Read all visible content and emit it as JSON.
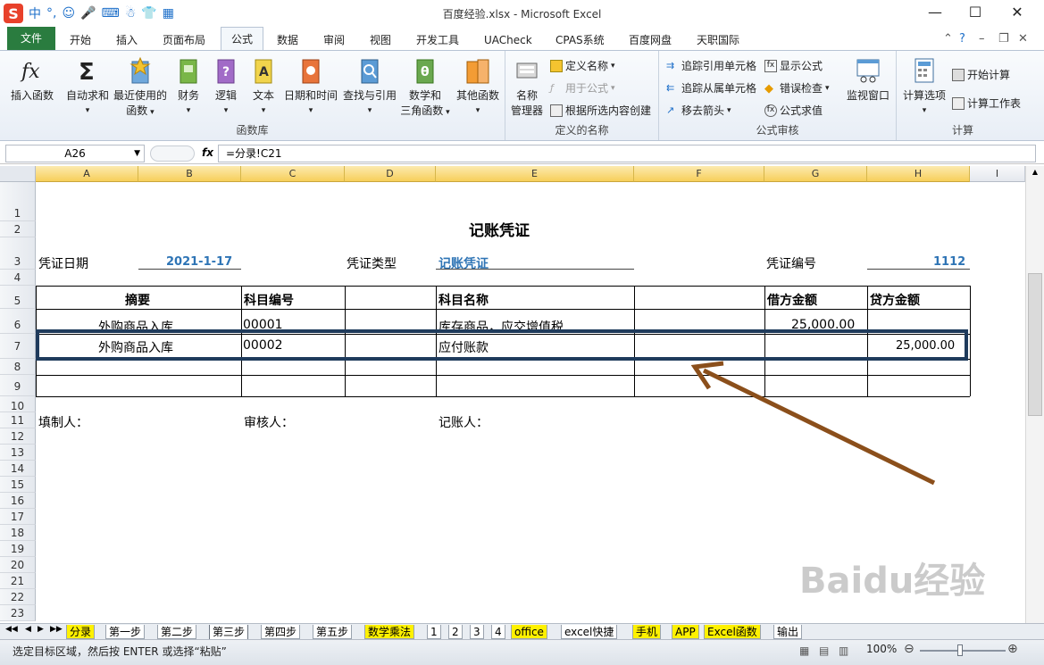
{
  "window": {
    "title": "百度经验.xlsx - Microsoft Excel"
  },
  "ime": {
    "label": "中"
  },
  "tabs": [
    "文件",
    "开始",
    "插入",
    "页面布局",
    "公式",
    "数据",
    "审阅",
    "视图",
    "开发工具",
    "UACheck",
    "CPAS系统",
    "百度网盘",
    "天职国际"
  ],
  "ribbon": {
    "function_library": {
      "label": "函数库",
      "buttons": {
        "insert_function": "插入函数",
        "autosum": "自动求和",
        "recent1": "最近使用的",
        "recent2": "函数",
        "financial": "财务",
        "logical": "逻辑",
        "text": "文本",
        "datetime": "日期和时间",
        "lookup": "查找与引用",
        "math1": "数学和",
        "math2": "三角函数",
        "more": "其他函数"
      }
    },
    "defined_names": {
      "label": "定义的名称",
      "buttons": {
        "name_manager1": "名称",
        "name_manager2": "管理器",
        "define_name": "定义名称",
        "use_in_formula": "用于公式",
        "create_from_selection": "根据所选内容创建"
      }
    },
    "formula_auditing": {
      "label": "公式审核",
      "buttons": {
        "trace_precedents": "追踪引用单元格",
        "trace_dependents": "追踪从属单元格",
        "remove_arrows": "移去箭头",
        "show_formulas": "显示公式",
        "error_checking": "错误检查",
        "evaluate": "公式求值",
        "watch_window": "监视窗口"
      }
    },
    "calculation": {
      "label": "计算",
      "buttons": {
        "options": "计算选项",
        "calc_now": "开始计算",
        "calc_sheet": "计算工作表"
      }
    }
  },
  "formula_bar": {
    "name_box": "A26",
    "fx": "fx",
    "formula": "=分录!C21"
  },
  "columns": [
    "A",
    "B",
    "C",
    "D",
    "E",
    "F",
    "G",
    "H",
    "I"
  ],
  "rows": [
    "1",
    "2",
    "3",
    "4",
    "5",
    "6",
    "7",
    "8",
    "9",
    "10",
    "11",
    "12",
    "13",
    "14",
    "15",
    "16",
    "17",
    "18",
    "19",
    "20",
    "21",
    "22",
    "23"
  ],
  "voucher": {
    "title": "记账凭证",
    "date_label": "凭证日期",
    "date_value": "2021-1-17",
    "type_label": "凭证类型",
    "type_value": "记账凭证",
    "number_label": "凭证编号",
    "number_value": "1112",
    "headers": {
      "summary": "摘要",
      "account_code": "科目编号",
      "account_name": "科目名称",
      "debit": "借方金额",
      "credit": "贷方金额"
    },
    "entries": [
      {
        "summary": "外购商品入库",
        "code": "00001",
        "name": "库存商品，应交增值税",
        "debit": "25,000.00",
        "credit": ""
      },
      {
        "summary": "外购商品入库",
        "code": "00002",
        "name": "应付账款",
        "debit": "",
        "credit": "25,000.00"
      }
    ],
    "footer": {
      "preparer": "填制人：",
      "reviewer": "审核人：",
      "bookkeeper": "记账人："
    }
  },
  "sheets": [
    {
      "label": "分录",
      "color": "yellow"
    },
    {
      "label": "第一步",
      "color": "none"
    },
    {
      "label": "第二步",
      "color": "none"
    },
    {
      "label": "第三步",
      "color": "active"
    },
    {
      "label": "第四步",
      "color": "none"
    },
    {
      "label": "第五步",
      "color": "none"
    },
    {
      "label": "数学乘法",
      "color": "yellow"
    },
    {
      "label": "1",
      "color": "none"
    },
    {
      "label": "2",
      "color": "none"
    },
    {
      "label": "3",
      "color": "none"
    },
    {
      "label": "4",
      "color": "none"
    },
    {
      "label": "office",
      "color": "yellow"
    },
    {
      "label": "excel快捷",
      "color": "none"
    },
    {
      "label": "手机",
      "color": "yellow"
    },
    {
      "label": "APP",
      "color": "yellow"
    },
    {
      "label": "Excel函数",
      "color": "yellow"
    },
    {
      "label": "输出",
      "color": "none"
    }
  ],
  "status": {
    "text": "选定目标区域，然后按 ENTER 或选择“粘贴”",
    "zoom": "100%"
  },
  "watermark": "Baidu经验",
  "colors": {
    "highlight_box": "#1f3b5c",
    "arrow": "#8b4f1b",
    "blue_text": "#2e74b5",
    "file_tab": "#2a7c3f"
  }
}
